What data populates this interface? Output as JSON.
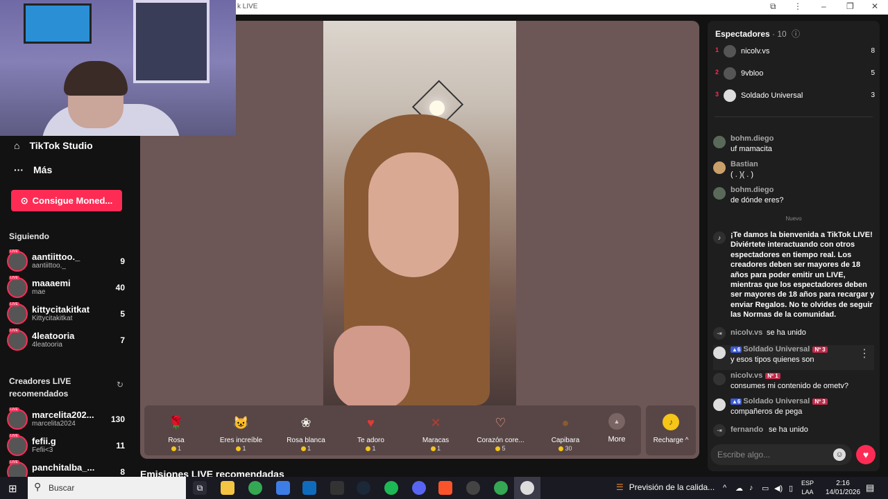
{
  "window": {
    "title_fragment": "k LIVE"
  },
  "sidebar": {
    "studio": "TikTok Studio",
    "more": "Más",
    "coins_button": "Consigue Moned...",
    "following_title": "Siguiendo",
    "following": [
      {
        "name": "aantiittoo._",
        "sub": "aantiittoo._",
        "count": "9"
      },
      {
        "name": "maaaemi",
        "sub": "mae",
        "count": "40"
      },
      {
        "name": "kittycitakitkat",
        "sub": "Kittycitakitkat",
        "count": "5"
      },
      {
        "name": "4leatooria",
        "sub": "4leatooria",
        "count": "7"
      }
    ],
    "recommended_title": "Creadores LIVE recomendados",
    "recommended": [
      {
        "name": "marcelita202...",
        "sub": "marcelita2024",
        "count": "130"
      },
      {
        "name": "fefii.g",
        "sub": "Fefii<3",
        "count": "11"
      },
      {
        "name": "panchitalba_...",
        "sub": "",
        "count": "8"
      }
    ]
  },
  "gifts": [
    {
      "name": "Rosa",
      "price": "1",
      "icon": "rose-icon",
      "glyph": "🌹",
      "color": "#c8344a"
    },
    {
      "name": "Eres increíble",
      "price": "1",
      "icon": "cat-icon",
      "glyph": "😺",
      "color": "#c59a6a"
    },
    {
      "name": "Rosa blanca",
      "price": "1",
      "icon": "white-rose-icon",
      "glyph": "❀",
      "color": "#f0efe6"
    },
    {
      "name": "Te adoro",
      "price": "1",
      "icon": "heart-face-icon",
      "glyph": "♥",
      "color": "#e53935"
    },
    {
      "name": "Maracas",
      "price": "1",
      "icon": "maracas-icon",
      "glyph": "✕",
      "color": "#c0392b"
    },
    {
      "name": "Corazón core...",
      "price": "5",
      "icon": "finger-heart-icon",
      "glyph": "♡",
      "color": "#f2a68c"
    },
    {
      "name": "Capibara",
      "price": "30",
      "icon": "capybara-icon",
      "glyph": "●",
      "color": "#8a5a30"
    }
  ],
  "more_label": "More",
  "recharge_label": "Recharge",
  "bottom_title": "Emisiones LIVE recomendadas",
  "viewers": {
    "title": "Espectadores",
    "count": "· 10",
    "list": [
      {
        "rank": "1",
        "name": "nicolv.vs",
        "score": "8"
      },
      {
        "rank": "2",
        "name": "9vbloo",
        "score": "5"
      },
      {
        "rank": "3",
        "name": "Soldado Universal",
        "score": "3"
      }
    ]
  },
  "chat": {
    "messages": [
      {
        "user": "bohm.diego",
        "text": "uf mamacita"
      },
      {
        "user": "Bastian",
        "text": "( . )( . )"
      },
      {
        "user": "bohm.diego",
        "text": "de dónde eres?"
      }
    ],
    "new_label": "Nuevo",
    "welcome": "¡Te damos la bienvenida a TikTok LIVE! Diviértete interactuando con otros espectadores en tiempo real. Los creadores deben ser mayores de 18 años para poder emitir un LIVE, mientras que los espectadores deben ser mayores de 18 años para recargar y enviar Regalos. No te olvides de seguir las Normas de la comunidad.",
    "joined_text": "se ha unido",
    "joined1": "nicolv.vs",
    "msg2_user": "Soldado Universal",
    "msg2_level": "6",
    "msg2_badge": "Nº 3",
    "msg2_text": "y esos tipos quienes son",
    "msg3_user": "nicolv.vs",
    "msg3_badge": "Nº 1",
    "msg3_text": "consumes mi contenido de ometv?",
    "msg4_user": "Soldado Universal",
    "msg4_level": "6",
    "msg4_badge": "Nº 3",
    "msg4_text": "compañeros de pega",
    "joined2": "fernando",
    "input_placeholder": "Escribe algo..."
  },
  "taskbar": {
    "search": "Buscar",
    "news": "Previsión de la calida...",
    "lang1": "ESP",
    "lang2": "LAA",
    "time": "2:16",
    "date": "14/01/2026"
  }
}
